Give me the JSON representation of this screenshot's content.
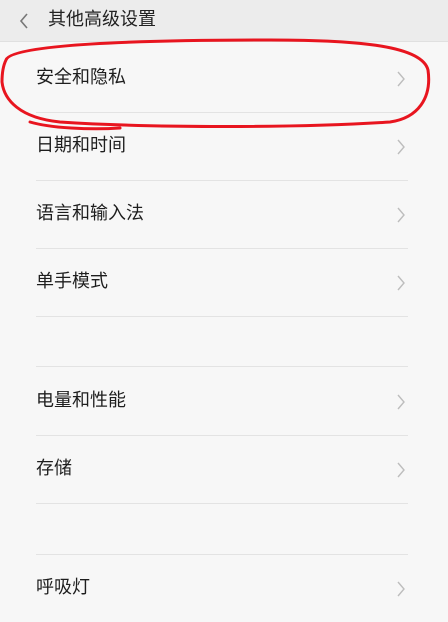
{
  "header": {
    "title": "其他高级设置",
    "back_icon": "chevron-left-icon"
  },
  "items": [
    {
      "label": "安全和隐私"
    },
    {
      "label": "日期和时间"
    },
    {
      "label": "语言和输入法"
    },
    {
      "label": "单手模式"
    },
    {
      "label": "电量和性能"
    },
    {
      "label": "存储"
    },
    {
      "label": "呼吸灯"
    }
  ],
  "colors": {
    "background": "#f7f7f7",
    "header_background": "#ececec",
    "text": "#1e1e1e",
    "chevron": "#bdbdbd",
    "annotation": "#e8151f"
  }
}
